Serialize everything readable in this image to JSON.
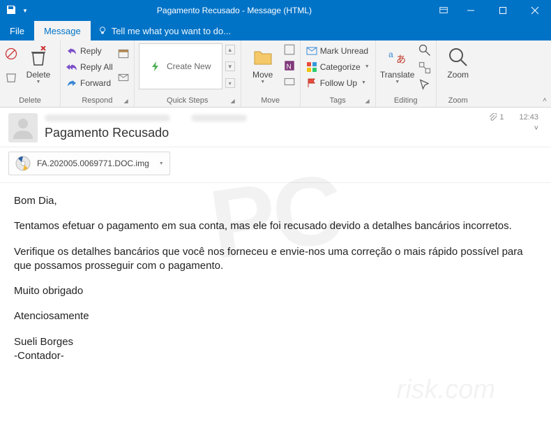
{
  "titlebar": {
    "title": "Pagamento Recusado - Message (HTML)"
  },
  "menu": {
    "file": "File",
    "message": "Message",
    "tellme": "Tell me what you want to do..."
  },
  "ribbon": {
    "delete": {
      "label": "Delete",
      "group": "Delete"
    },
    "respond": {
      "reply": "Reply",
      "reply_all": "Reply All",
      "forward": "Forward",
      "group": "Respond"
    },
    "quicksteps": {
      "create": "Create New",
      "group": "Quick Steps"
    },
    "move": {
      "move": "Move",
      "group": "Move"
    },
    "tags": {
      "unread": "Mark Unread",
      "categorize": "Categorize",
      "followup": "Follow Up",
      "group": "Tags"
    },
    "editing": {
      "translate": "Translate",
      "group": "Editing"
    },
    "zoom": {
      "zoom": "Zoom",
      "group": "Zoom"
    }
  },
  "header": {
    "subject": "Pagamento Recusado",
    "attachment_count": "1",
    "time": "12:43"
  },
  "attachment": {
    "filename": "FA.202005.0069771.DOC.img"
  },
  "body": {
    "p1": "Bom Dia,",
    "p2": "Tentamos efetuar o pagamento em sua conta, mas ele foi recusado devido a detalhes bancários incorretos.",
    "p3": "Verifique os detalhes bancários que você nos forneceu e envie-nos uma correção o mais rápido possível para que possamos prosseguir com o pagamento.",
    "p4": "Muito obrigado",
    "p5": "Atenciosamente",
    "p6": "Sueli Borges",
    "p7": "-Contador-"
  },
  "watermark": {
    "main": "PC",
    "sub": "risk.com"
  }
}
